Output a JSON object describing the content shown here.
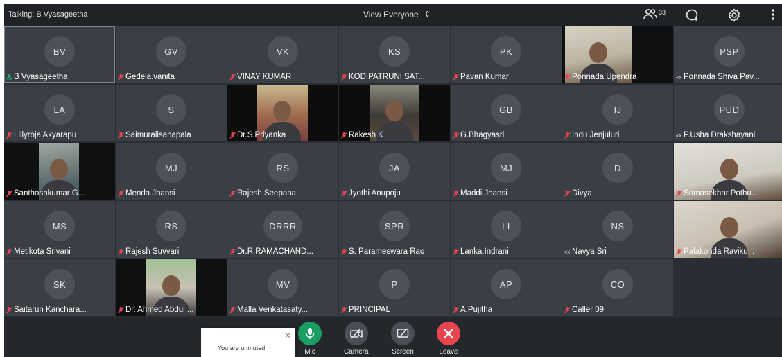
{
  "topbar": {
    "talking": "Talking: B Vyasageetha",
    "view_label": "View Everyone",
    "participant_count": "33"
  },
  "participants": [
    {
      "initials": "BV",
      "name": "B Vyasageetha",
      "mic": "active"
    },
    {
      "initials": "GV",
      "name": "Gedela.vanita",
      "mic": "muted"
    },
    {
      "initials": "VK",
      "name": "VINAY KUMAR",
      "mic": "muted"
    },
    {
      "initials": "KS",
      "name": "KODIPATRUNI SAT...",
      "mic": "muted"
    },
    {
      "initials": "PK",
      "name": "Pavan Kumar",
      "mic": "muted"
    },
    {
      "initials": "",
      "name": "Ponnada Upendra",
      "mic": "muted"
    },
    {
      "initials": "PSP",
      "name": "Ponnada Shiva Pav...",
      "mic": "dialin"
    },
    {
      "initials": "LA",
      "name": "Lillyroja Akyarapu",
      "mic": "muted"
    },
    {
      "initials": "S",
      "name": "Saimuralisanapala",
      "mic": "muted"
    },
    {
      "initials": "",
      "name": "Dr.S.Priyanka",
      "mic": "muted"
    },
    {
      "initials": "",
      "name": "Rakesh K",
      "mic": "muted"
    },
    {
      "initials": "GB",
      "name": "G.Bhagyasri",
      "mic": "muted"
    },
    {
      "initials": "IJ",
      "name": "Indu Jenjuluri",
      "mic": "muted"
    },
    {
      "initials": "PUD",
      "name": "P.Usha Drakshayani",
      "mic": "dialin"
    },
    {
      "initials": "",
      "name": "Santhoshkumar G...",
      "mic": "muted"
    },
    {
      "initials": "MJ",
      "name": "Menda Jhansi",
      "mic": "muted"
    },
    {
      "initials": "RS",
      "name": "Rajesh Seepana",
      "mic": "muted"
    },
    {
      "initials": "JA",
      "name": "Jyothi Anupoju",
      "mic": "muted"
    },
    {
      "initials": "MJ",
      "name": "Maddi Jhansi",
      "mic": "muted"
    },
    {
      "initials": "D",
      "name": "Divya",
      "mic": "muted"
    },
    {
      "initials": "",
      "name": "Somasekhar Pothu...",
      "mic": "muted"
    },
    {
      "initials": "MS",
      "name": "Metikota Srivani",
      "mic": "muted"
    },
    {
      "initials": "RS",
      "name": "Rajesh Suvvari",
      "mic": "muted"
    },
    {
      "initials": "DRRR",
      "name": "Dr.R.RAMACHAND...",
      "mic": "muted"
    },
    {
      "initials": "SPR",
      "name": "S. Parameswara Rao",
      "mic": "muted"
    },
    {
      "initials": "LI",
      "name": "Lanka.Indrani",
      "mic": "muted"
    },
    {
      "initials": "NS",
      "name": "Navya Sri",
      "mic": "dialin"
    },
    {
      "initials": "",
      "name": "Palakonda Raviku...",
      "mic": "muted"
    },
    {
      "initials": "SK",
      "name": "Saitarun Kanchara...",
      "mic": "muted"
    },
    {
      "initials": "",
      "name": "Dr. Ahmed Abdul ...",
      "mic": "muted"
    },
    {
      "initials": "MV",
      "name": "Malla Venkatasaty...",
      "mic": "muted"
    },
    {
      "initials": "P",
      "name": "PRINCIPAL",
      "mic": "muted"
    },
    {
      "initials": "AP",
      "name": "A.Pujitha",
      "mic": "muted"
    },
    {
      "initials": "CO",
      "name": "Caller 09",
      "mic": "muted"
    }
  ],
  "toast": {
    "message": "You are unmuted."
  },
  "controls": {
    "mic": "Mic",
    "camera": "Camera",
    "screen": "Screen",
    "leave": "Leave"
  },
  "colors": {
    "background": "#2a2d33",
    "tile": "#3a3e45",
    "avatar": "#4d525a",
    "muted_red": "#e8454f",
    "active_green": "#1faa6b",
    "mic_button": "#1b9e62",
    "leave_button": "#e8454f",
    "neutral_button": "#4a4e56"
  },
  "icons": {
    "view_toggle": "up-down-arrows-icon",
    "participants": "people-icon",
    "chat": "chat-bubble-icon",
    "settings": "gear-icon",
    "more": "kebab-menu-icon",
    "muted": "mic-muted-icon",
    "active": "mic-active-icon",
    "dialin": "phone-dialin-icon"
  }
}
